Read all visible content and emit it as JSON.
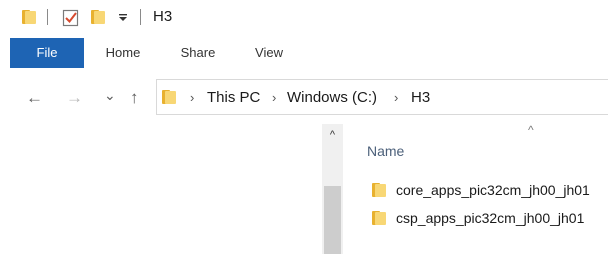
{
  "title_bar": {
    "quick_access": [
      "folder-icon",
      "properties-icon",
      "new-folder-icon",
      "customize-dropdown-icon"
    ],
    "title": "H3"
  },
  "ribbon": {
    "tabs": [
      {
        "label": "File",
        "active": true
      },
      {
        "label": "Home"
      },
      {
        "label": "Share"
      },
      {
        "label": "View"
      }
    ],
    "active_color": "#1e64b4"
  },
  "navigation": {
    "back_glyph": "←",
    "forward_glyph": "→",
    "recent_glyph": "⌄",
    "up_glyph": "↑"
  },
  "address_bar": {
    "separator": "›",
    "crumbs": [
      "This PC",
      "Windows (C:)",
      "H3"
    ]
  },
  "file_list": {
    "column_header": "Name",
    "sort_glyph": "^",
    "items": [
      {
        "name": "core_apps_pic32cm_jh00_jh01",
        "icon": "folder-icon"
      },
      {
        "name": "csp_apps_pic32cm_jh00_jh01",
        "icon": "folder-icon"
      }
    ]
  },
  "scrollbar": {
    "up_glyph": "^"
  }
}
